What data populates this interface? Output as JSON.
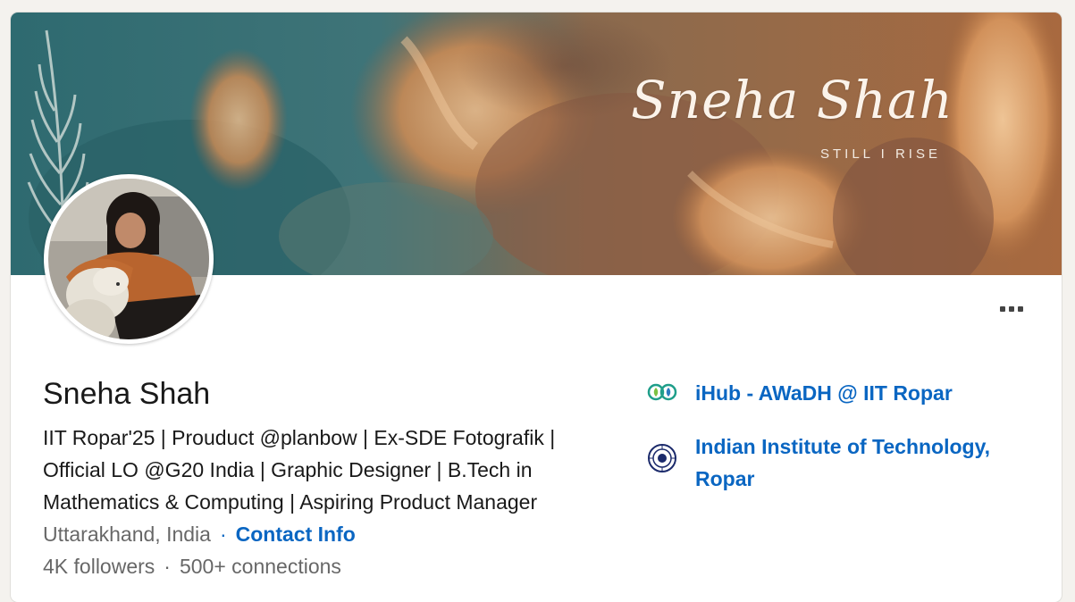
{
  "profile": {
    "banner": {
      "name": "Sneha Shah",
      "tagline": "STILL I RISE"
    },
    "name": "Sneha Shah",
    "headline": "IIT Ropar'25 | Prouduct @planbow | Ex-SDE Fotografik | Official LO @G20 India | Graphic Designer | B.Tech in Mathematics & Computing | Aspiring Product Manager",
    "location": "Uttarakhand, India",
    "contact_link": "Contact Info",
    "followers": "4K followers",
    "connections": "500+ connections"
  },
  "experience": [
    {
      "label": "iHub - AWaDH @ IIT Ropar",
      "logo": "ihub-awadh-logo"
    },
    {
      "label": "Indian Institute of Technology, Ropar",
      "logo": "iit-ropar-logo"
    }
  ],
  "actions": {
    "more_icon": "more-horizontal-icon"
  },
  "colors": {
    "link": "#0a66c2",
    "banner_teal": "#2f6f74",
    "banner_ochre": "#c58a55"
  }
}
